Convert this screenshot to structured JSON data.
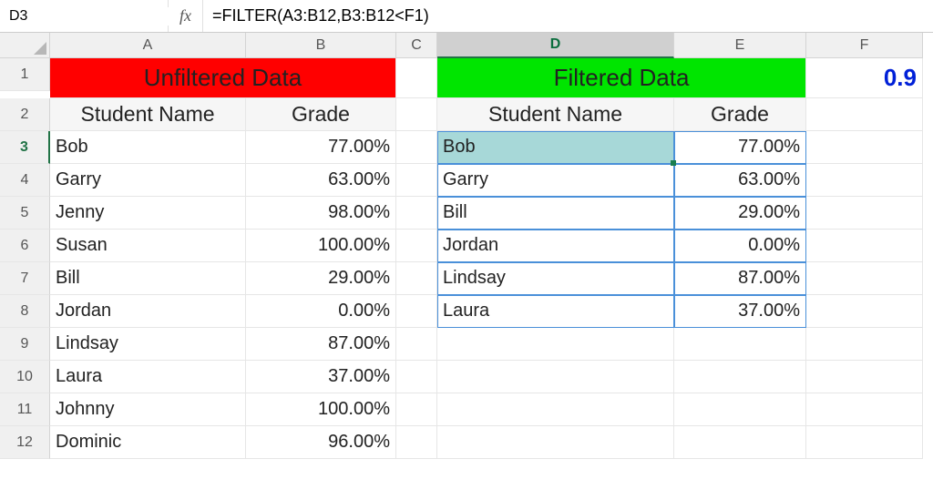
{
  "name_box": "D3",
  "fx_label": "fx",
  "formula": "=FILTER(A3:B12,B3:B12<F1)",
  "columns": [
    "A",
    "B",
    "C",
    "D",
    "E",
    "F"
  ],
  "active_column": "D",
  "active_row": 3,
  "rows": [
    1,
    2,
    3,
    4,
    5,
    6,
    7,
    8,
    9,
    10,
    11,
    12
  ],
  "titles": {
    "unfiltered": "Unfiltered Data",
    "filtered": "Filtered Data"
  },
  "headers": {
    "student": "Student Name",
    "grade": "Grade"
  },
  "threshold": "0.9",
  "unfiltered": [
    {
      "name": "Bob",
      "grade": "77.00%"
    },
    {
      "name": "Garry",
      "grade": "63.00%"
    },
    {
      "name": "Jenny",
      "grade": "98.00%"
    },
    {
      "name": "Susan",
      "grade": "100.00%"
    },
    {
      "name": "Bill",
      "grade": "29.00%"
    },
    {
      "name": "Jordan",
      "grade": "0.00%"
    },
    {
      "name": "Lindsay",
      "grade": "87.00%"
    },
    {
      "name": "Laura",
      "grade": "37.00%"
    },
    {
      "name": "Johnny",
      "grade": "100.00%"
    },
    {
      "name": "Dominic",
      "grade": "96.00%"
    }
  ],
  "filtered": [
    {
      "name": "Bob",
      "grade": "77.00%"
    },
    {
      "name": "Garry",
      "grade": "63.00%"
    },
    {
      "name": "Bill",
      "grade": "29.00%"
    },
    {
      "name": "Jordan",
      "grade": "0.00%"
    },
    {
      "name": "Lindsay",
      "grade": "87.00%"
    },
    {
      "name": "Laura",
      "grade": "37.00%"
    }
  ]
}
